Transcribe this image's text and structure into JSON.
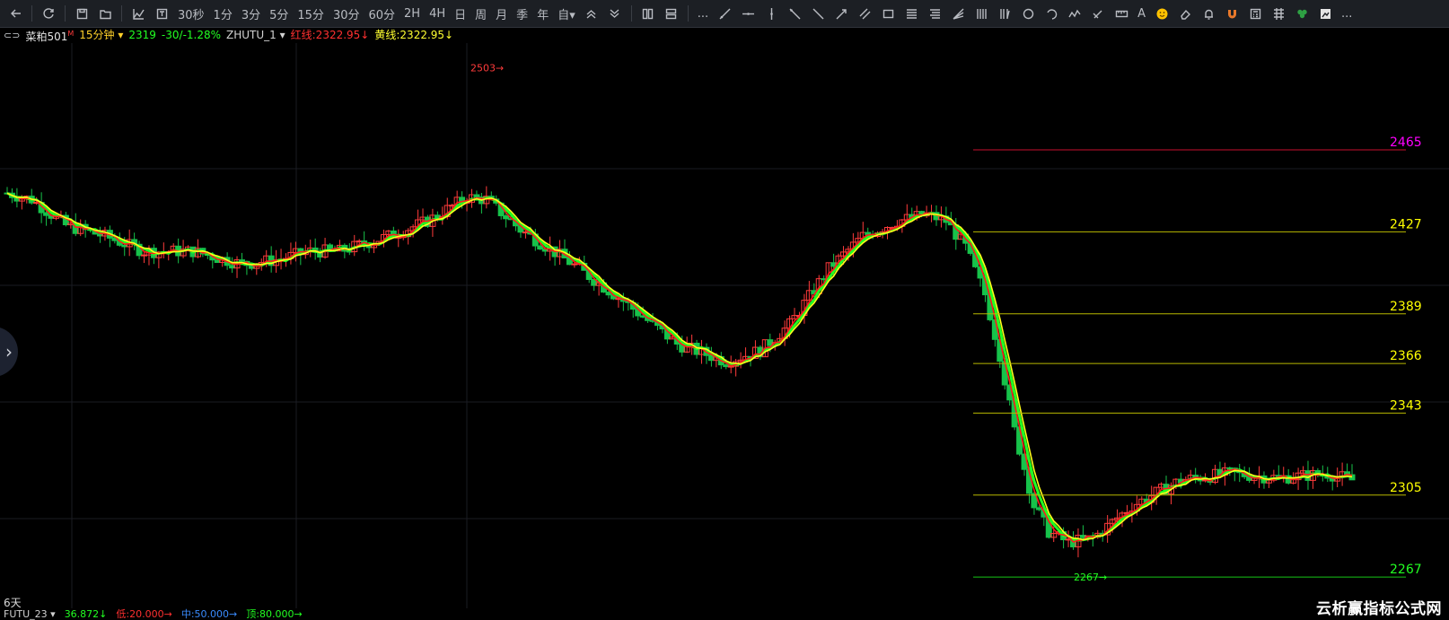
{
  "toolbar": {
    "items": [
      {
        "name": "back-icon",
        "type": "icon"
      },
      {
        "type": "sep"
      },
      {
        "name": "refresh-icon",
        "type": "icon"
      },
      {
        "type": "sep"
      },
      {
        "name": "save-icon",
        "type": "icon"
      },
      {
        "name": "open-folder-icon",
        "type": "icon"
      },
      {
        "type": "sep"
      },
      {
        "name": "line-chart-icon",
        "type": "icon"
      },
      {
        "name": "indicator-icon",
        "type": "icon"
      },
      {
        "name": "period-30s",
        "type": "text",
        "label": "30秒"
      },
      {
        "name": "period-1m",
        "type": "text",
        "label": "1分"
      },
      {
        "name": "period-3m",
        "type": "text",
        "label": "3分"
      },
      {
        "name": "period-5m",
        "type": "text",
        "label": "5分"
      },
      {
        "name": "period-15m",
        "type": "text",
        "label": "15分"
      },
      {
        "name": "period-30m",
        "type": "text",
        "label": "30分"
      },
      {
        "name": "period-60m",
        "type": "text",
        "label": "60分"
      },
      {
        "name": "period-2h",
        "type": "text",
        "label": "2H"
      },
      {
        "name": "period-4h",
        "type": "text",
        "label": "4H"
      },
      {
        "name": "period-day",
        "type": "text",
        "label": "日"
      },
      {
        "name": "period-week",
        "type": "text",
        "label": "周"
      },
      {
        "name": "period-month",
        "type": "text",
        "label": "月"
      },
      {
        "name": "period-season",
        "type": "text",
        "label": "季"
      },
      {
        "name": "period-year",
        "type": "text",
        "label": "年"
      },
      {
        "name": "period-custom",
        "type": "text",
        "label": "自▾"
      },
      {
        "name": "zoom-in-icon",
        "type": "icon"
      },
      {
        "name": "zoom-out-icon",
        "type": "icon"
      },
      {
        "type": "sep"
      },
      {
        "name": "layout-columns-icon",
        "type": "icon"
      },
      {
        "name": "layout-rows-icon",
        "type": "icon"
      },
      {
        "type": "sep"
      },
      {
        "name": "more-icon",
        "type": "text",
        "label": "..."
      },
      {
        "name": "draw-line-icon",
        "type": "icon"
      },
      {
        "name": "horizontal-line-icon",
        "type": "icon"
      },
      {
        "name": "vertical-line-icon",
        "type": "icon"
      },
      {
        "name": "ray-icon",
        "type": "icon"
      },
      {
        "name": "segment-icon",
        "type": "icon"
      },
      {
        "name": "arrow-line-icon",
        "type": "icon"
      },
      {
        "name": "parallel-lines-icon",
        "type": "icon"
      },
      {
        "name": "rectangle-icon",
        "type": "icon"
      },
      {
        "name": "fibonacci-icon",
        "type": "icon"
      },
      {
        "name": "golden-ratio-icon",
        "type": "icon"
      },
      {
        "name": "gann-fan-icon",
        "type": "icon"
      },
      {
        "name": "cycle-lines-icon",
        "type": "icon"
      },
      {
        "name": "period-lines-icon",
        "type": "icon"
      },
      {
        "name": "circle-icon",
        "type": "icon"
      },
      {
        "name": "arc-icon",
        "type": "icon"
      },
      {
        "name": "wave-icon",
        "type": "icon"
      },
      {
        "name": "brush-icon",
        "type": "icon"
      },
      {
        "name": "ruler-icon",
        "type": "icon"
      },
      {
        "name": "text-tool-icon",
        "type": "text",
        "label": "A"
      },
      {
        "name": "emoji-icon",
        "type": "icon"
      },
      {
        "name": "eraser-icon",
        "type": "icon"
      },
      {
        "name": "alert-bell-icon",
        "type": "icon"
      },
      {
        "name": "magnet-icon",
        "type": "icon"
      },
      {
        "name": "calculator-icon",
        "type": "icon"
      },
      {
        "name": "grid-icon",
        "type": "icon"
      },
      {
        "name": "clover-icon",
        "type": "icon"
      },
      {
        "name": "screenshot-icon",
        "type": "icon"
      },
      {
        "name": "more-tools-icon",
        "type": "text",
        "label": "..."
      }
    ]
  },
  "infobar": {
    "symbol": "菜粕501",
    "symbol_tag": "M",
    "period": "15分钟",
    "price": "2319",
    "change": "-30/-1.28%",
    "formula": "ZHUTU_1",
    "red_line": "红线:2322.95↓",
    "yellow_line": "黄线:2322.95↓"
  },
  "chart": {
    "y_range": [
      2260,
      2512
    ],
    "high_label": "2503",
    "low_label": "2267",
    "fib_levels": [
      {
        "value": 2465,
        "label": "2465",
        "line_color": "#c8102e",
        "text_color": "#ff00ff"
      },
      {
        "value": 2427,
        "label": "2427",
        "line_color": "#b8b800",
        "text_color": "#ffff00"
      },
      {
        "value": 2389,
        "label": "2389",
        "line_color": "#b8b800",
        "text_color": "#ffff00"
      },
      {
        "value": 2366,
        "label": "2366",
        "line_color": "#b8b800",
        "text_color": "#ffff00"
      },
      {
        "value": 2343,
        "label": "2343",
        "line_color": "#b8b800",
        "text_color": "#ffff00"
      },
      {
        "value": 2305,
        "label": "2305",
        "line_color": "#b8b800",
        "text_color": "#ffff00"
      },
      {
        "value": 2267,
        "label": "2267",
        "line_color": "#16c616",
        "text_color": "#22ff22"
      }
    ],
    "colors": {
      "up": "#ff3b3b",
      "down": "#17c24a",
      "red_ma": "#ff1a1a",
      "yellow_ma": "#ffff1a",
      "green_ma": "#22ff22",
      "grid": "#1a1c22"
    }
  },
  "bottom": {
    "period_label": "6天",
    "indicator": "FUTU_23",
    "value": "36.872↓",
    "low": "低:20.000→",
    "mid": "中:50.000→",
    "high": "顶:80.000→"
  },
  "watermark": "云析赢指标公式网"
}
